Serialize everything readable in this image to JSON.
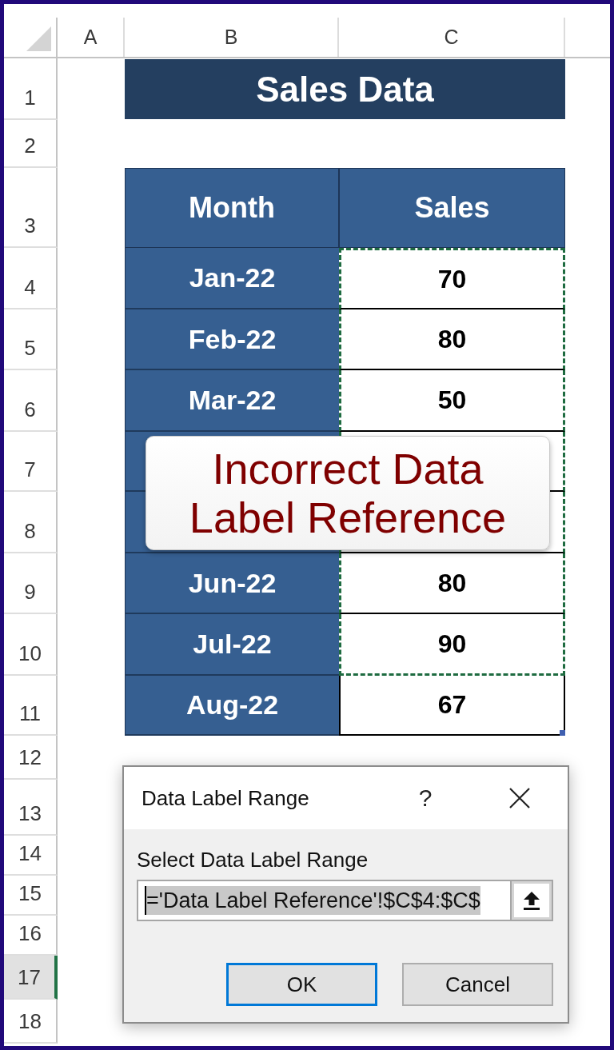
{
  "sheet": {
    "column_headers": [
      "A",
      "B",
      "C"
    ],
    "row_headers": [
      {
        "label": "1",
        "selected": false
      },
      {
        "label": "2",
        "selected": false
      },
      {
        "label": "3",
        "selected": false
      },
      {
        "label": "4",
        "selected": false
      },
      {
        "label": "5",
        "selected": false
      },
      {
        "label": "6",
        "selected": false
      },
      {
        "label": "7",
        "selected": false
      },
      {
        "label": "8",
        "selected": false
      },
      {
        "label": "9",
        "selected": false
      },
      {
        "label": "10",
        "selected": false
      },
      {
        "label": "11",
        "selected": false
      },
      {
        "label": "12",
        "selected": false
      },
      {
        "label": "13",
        "selected": false
      },
      {
        "label": "14",
        "selected": false
      },
      {
        "label": "15",
        "selected": false
      },
      {
        "label": "16",
        "selected": false
      },
      {
        "label": "17",
        "selected": true
      },
      {
        "label": "18",
        "selected": false
      }
    ]
  },
  "title": "Sales Data",
  "table": {
    "columns": [
      "Month",
      "Sales"
    ],
    "rows": [
      {
        "month": "Jan-22",
        "sales": "70",
        "marked": true,
        "corner_handle": false
      },
      {
        "month": "Feb-22",
        "sales": "80",
        "marked": true,
        "corner_handle": false
      },
      {
        "month": "Mar-22",
        "sales": "50",
        "marked": true,
        "corner_handle": false
      },
      {
        "marked": true,
        "corner_handle": false
      },
      {
        "marked": true,
        "corner_handle": false
      },
      {
        "month": "Jun-22",
        "sales": "80",
        "marked": true,
        "corner_handle": false
      },
      {
        "month": "Jul-22",
        "sales": "90",
        "marked": true,
        "corner_handle": false
      },
      {
        "month": "Aug-22",
        "sales": "67",
        "marked": false,
        "corner_handle": true
      }
    ]
  },
  "callout": {
    "text": "Incorrect Data Label Reference"
  },
  "dialog": {
    "title": "Data Label Range",
    "help": "?",
    "field_label": "Select Data Label Range",
    "field": {
      "value": "='Data Label Reference'!$C$4:$C$",
      "selected": true
    },
    "buttons": [
      {
        "label": "OK",
        "focused": true
      },
      {
        "label": "Cancel",
        "focused": false
      }
    ]
  }
}
